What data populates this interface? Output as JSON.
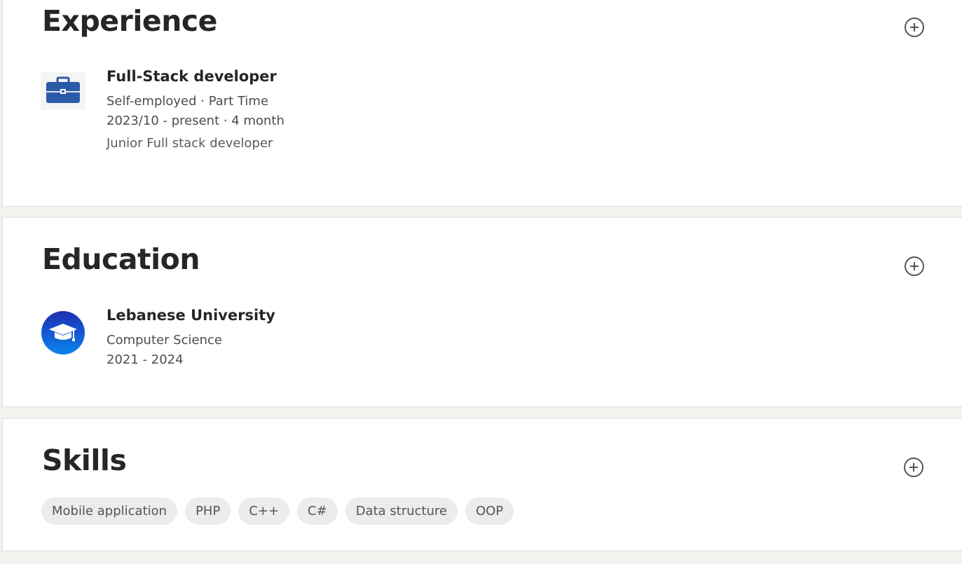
{
  "experience": {
    "title": "Experience",
    "icon": "briefcase-icon",
    "entries": [
      {
        "title": "Full-Stack developer",
        "meta": "Self-employed · Part Time",
        "dates": "2023/10 - present · 4 month",
        "description": "Junior Full stack developer"
      }
    ]
  },
  "education": {
    "title": "Education",
    "icon": "graduation-cap-icon",
    "entries": [
      {
        "title": "Lebanese University",
        "field": "Computer Science",
        "dates": "2021 - 2024"
      }
    ]
  },
  "skills": {
    "title": "Skills",
    "items": [
      "Mobile application",
      "PHP",
      "C++",
      "C#",
      "Data structure",
      "OOP"
    ]
  },
  "colors": {
    "page_background": "#f3f2ef",
    "card_background": "#ffffff",
    "briefcase_blue": "#2a5ba8",
    "education_blue": "#0a58e0",
    "chip_background": "#ececec"
  }
}
